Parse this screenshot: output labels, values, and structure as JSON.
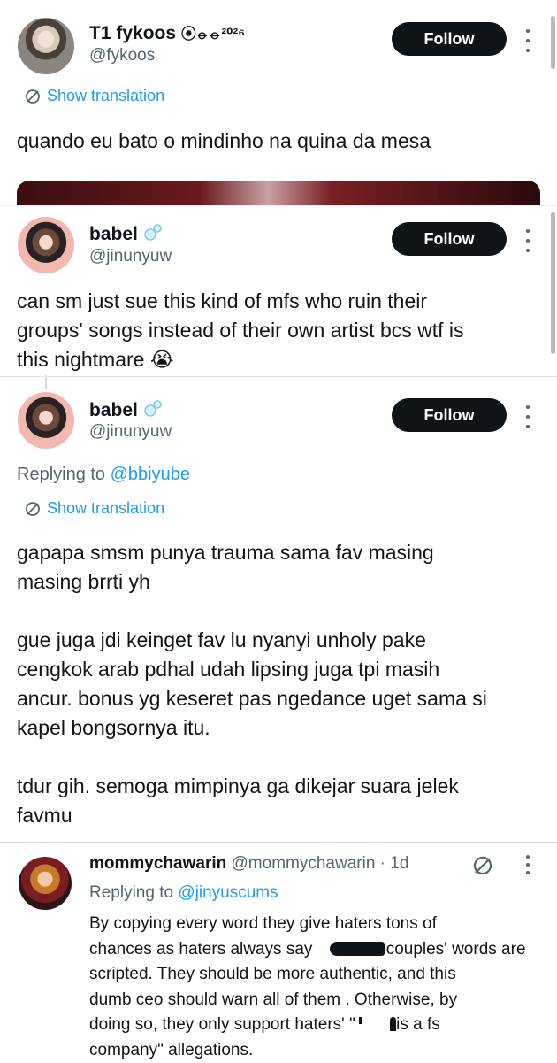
{
  "follow_label": "Follow",
  "show_translation": "Show translation",
  "tweet1": {
    "name": "T1 fykoos",
    "name_suffix": "⦿⦵⦵²⁰²⁶",
    "handle": "@fykoos",
    "text": "quando eu bato o mindinho na quina da mesa"
  },
  "tweet2": {
    "name": "babel",
    "handle": "@jinunyuw",
    "lines": [
      "can sm just sue this kind of mfs who ruin their",
      "groups' songs instead of their own artist bcs wtf is",
      "this nightmare 😭"
    ]
  },
  "tweet3": {
    "name": "babel",
    "handle": "@jinunyuw",
    "replying_prefix": "Replying to",
    "replying_handle": "@bbiyube",
    "para1": [
      "gapapa smsm punya trauma sama fav masing",
      "masing brrti yh"
    ],
    "para2": [
      "gue juga jdi keinget fav lu nyanyi unholy pake",
      "cengkok arab pdhal udah lipsing juga tpi masih",
      "ancur. bonus yg keseret pas ngedance uget sama si",
      "kapel bongsornya itu."
    ],
    "para3": [
      "tdur gih. semoga mimpinya ga dikejar suara jelek",
      "favmu"
    ]
  },
  "tweet4": {
    "name": "mommychawarin",
    "handle": "@mommychawarin",
    "time": "· 1d",
    "replying_prefix": "Replying to",
    "replying_handle": "@jinyuscums",
    "lines": [
      "By copying every word they give haters tons of",
      "chances as haters always say",
      "couples' words are",
      "scripted. They should be more authentic, and this",
      "dumb ceo should warn all of them . Otherwise, by",
      "doing so, they only support haters' \"",
      "is a fs",
      "company\" allegations."
    ]
  },
  "colors": {
    "accent": "#1d9bf0",
    "text": "#0f1419",
    "muted": "#536471",
    "button": "#0f1419"
  }
}
